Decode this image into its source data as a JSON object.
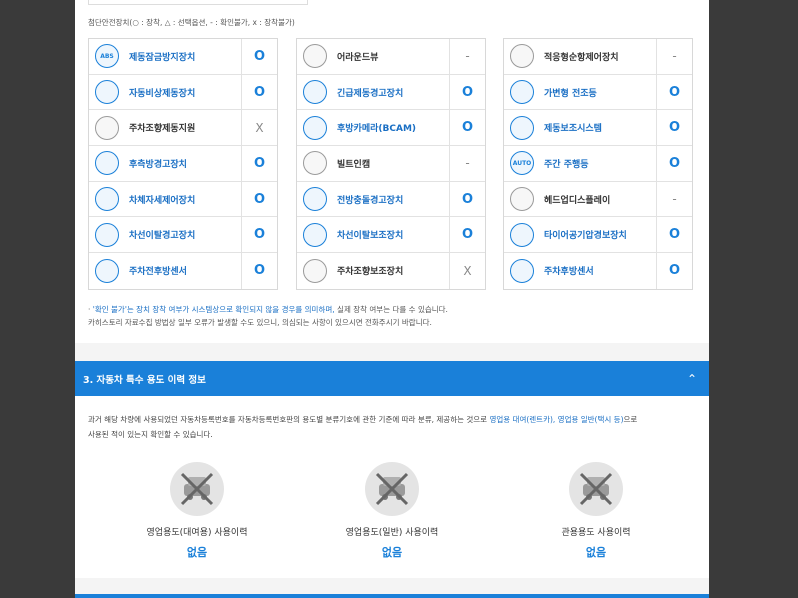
{
  "legend": "첨단안전장치(○ : 장착, △ : 선택옵션, - : 확인불가, x : 장착불가)",
  "colors": {
    "accent": "#1a80d9",
    "section_bar": "#1a80d9"
  },
  "columns": [
    [
      {
        "label": "제동잠금방지장치",
        "status": "O",
        "icon": "abs-icon",
        "icon_text": "ABS",
        "active": true
      },
      {
        "label": "자동비상제동장치",
        "status": "O",
        "icon": "emergency-brake-icon",
        "icon_text": "",
        "active": true
      },
      {
        "label": "주차조향제동지원",
        "status": "X",
        "icon": "parking-steer-icon",
        "icon_text": "",
        "active": false
      },
      {
        "label": "후측방경고장치",
        "status": "O",
        "icon": "rear-side-warning-icon",
        "icon_text": "",
        "active": true
      },
      {
        "label": "차체자세제어장치",
        "status": "O",
        "icon": "stability-control-icon",
        "icon_text": "",
        "active": true
      },
      {
        "label": "차선이탈경고장치",
        "status": "O",
        "icon": "lane-departure-warning-icon",
        "icon_text": "",
        "active": true
      },
      {
        "label": "주차전후방센서",
        "status": "O",
        "icon": "parking-sensor-icon",
        "icon_text": "",
        "active": true
      }
    ],
    [
      {
        "label": "어라운드뷰",
        "status": "-",
        "icon": "around-view-icon",
        "icon_text": "",
        "active": false
      },
      {
        "label": "긴급제동경고장치",
        "status": "O",
        "icon": "emergency-brake-warning-icon",
        "icon_text": "",
        "active": true
      },
      {
        "label": "후방카메라(BCAM)",
        "status": "O",
        "icon": "rear-camera-icon",
        "icon_text": "",
        "active": true
      },
      {
        "label": "빌트인캠",
        "status": "-",
        "icon": "builtin-cam-icon",
        "icon_text": "",
        "active": false
      },
      {
        "label": "전방충돌경고장치",
        "status": "O",
        "icon": "forward-collision-icon",
        "icon_text": "",
        "active": true
      },
      {
        "label": "차선이탈보조장치",
        "status": "O",
        "icon": "lane-keeping-assist-icon",
        "icon_text": "",
        "active": true
      },
      {
        "label": "주차조향보조장치",
        "status": "X",
        "icon": "parking-assist-icon",
        "icon_text": "",
        "active": false
      }
    ],
    [
      {
        "label": "적응형순항제어장치",
        "status": "-",
        "icon": "adaptive-cruise-icon",
        "icon_text": "",
        "active": false
      },
      {
        "label": "가변형 전조등",
        "status": "O",
        "icon": "adaptive-headlight-icon",
        "icon_text": "",
        "active": true
      },
      {
        "label": "제동보조시스템",
        "status": "O",
        "icon": "brake-assist-icon",
        "icon_text": "",
        "active": true
      },
      {
        "label": "주간 주행등",
        "status": "O",
        "icon": "daytime-running-light-icon",
        "icon_text": "AUTO",
        "active": true
      },
      {
        "label": "헤드업디스플레이",
        "status": "-",
        "icon": "head-up-display-icon",
        "icon_text": "",
        "active": false
      },
      {
        "label": "타이어공기압경보장치",
        "status": "O",
        "icon": "tire-pressure-icon",
        "icon_text": "",
        "active": true
      },
      {
        "label": "주차후방센서",
        "status": "O",
        "icon": "rear-parking-sensor-icon",
        "icon_text": "",
        "active": true
      }
    ]
  ],
  "notes": {
    "line1_prefix": "· ",
    "line1_highlight": "'확인 불가'는 장치 장착 여부가 시스템상으로 확인되지 않을 경우를 의미하며,",
    "line1_rest": " 실제 장착 여부는 다를 수 있습니다.",
    "line2": "카히스토리 자료수집 방법상 일부 오류가 발생할 수도 있으니, 의심되는 사항이 있으시면 전화주시기 바랍니다."
  },
  "section3": {
    "title": "3. 자동차 특수 용도 이력 정보",
    "toggle_icon": "chevron-up-icon",
    "desc_part1": "과거 해당 차량에 사용되었던 자동차등록번호를 자동차등록번호판의 용도별 분류기호에 관한 기준에 따라 분류, 제공하는 것으로 ",
    "desc_highlight": "영업용 대여(렌트카), 영업용 일반(택시 등)",
    "desc_part2": "으로",
    "desc_line2": "사용된 적이 있는지 확인할 수 있습니다.",
    "items": [
      {
        "label": "영업용도(대여용) 사용이력",
        "value": "없음",
        "icon": "rental-car-icon"
      },
      {
        "label": "영업용도(일반) 사용이력",
        "value": "없음",
        "icon": "taxi-icon"
      },
      {
        "label": "관용용도 사용이력",
        "value": "없음",
        "icon": "government-vehicle-icon"
      }
    ]
  }
}
